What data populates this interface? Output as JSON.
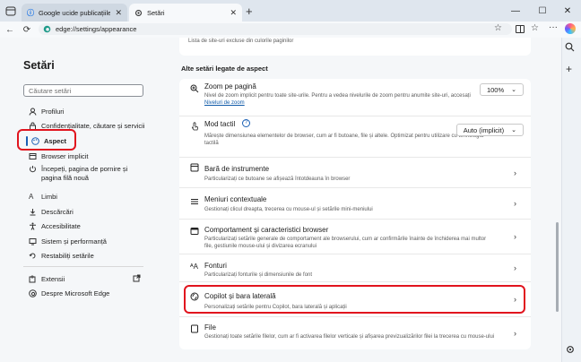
{
  "tabs": [
    {
      "title": "Google ucide publicațiile indepe"
    },
    {
      "title": "Setări"
    }
  ],
  "address": {
    "url": "edge://settings/appearance"
  },
  "sidebar": {
    "title": "Setări",
    "search_placeholder": "Căutare setări",
    "items": [
      {
        "label": "Profiluri"
      },
      {
        "label": "Confidențialitate, căutare și servicii"
      },
      {
        "label": "Aspect"
      },
      {
        "label": "Browser implicit"
      },
      {
        "label": "Începeți, pagina de pornire și"
      },
      {
        "label": "Limbi"
      },
      {
        "label": "Descărcări"
      },
      {
        "label": "Accesibilitate"
      },
      {
        "label": "Sistem și performanță"
      },
      {
        "label": "Restabiliți setările"
      },
      {
        "label": "Extensii"
      },
      {
        "label": "Despre Microsoft Edge"
      }
    ],
    "item4_line2": "pagina filă nouă"
  },
  "main": {
    "top_text": "Lista de site-uri excluse din culorile paginilor",
    "section_title": "Alte setări legate de aspect",
    "zoom": {
      "title": "Zoom pe pagină",
      "desc": "Nivel de zoom implicit pentru toate site-urile. Pentru a vedea nivelurile de zoom pentru anumite site-uri, accesați",
      "link": "Niveluri de zoom",
      "value": "100%"
    },
    "touch": {
      "title": "Mod tactil",
      "desc": "Mărește dimensiunea elementelor de browser, cum ar fi butoane, file și altele. Optimizat pentru utilizare cu tehnologia tactilă",
      "value": "Auto (implicit)"
    },
    "rows": [
      {
        "title": "Bară de instrumente",
        "desc": "Particularizați ce butoane se afișează întotdeauna în browser"
      },
      {
        "title": "Meniuri contextuale",
        "desc": "Gestionați clicul dreapta, trecerea cu mouse-ul și setările mini-meniului"
      },
      {
        "title": "Comportament și caracteristici browser",
        "desc": "Particularizați setările generale de comportament ale browserului, cum ar confirmările înainte de închiderea mai multor file, gestiunile mouse-ului și divizarea ecranului"
      },
      {
        "title": "Fonturi",
        "desc": "Particularizați fonturile și dimensiunile de font"
      },
      {
        "title": "Copilot și bara laterală",
        "desc": "Personalizați setările pentru Copilot, bara laterală și aplicații"
      },
      {
        "title": "File",
        "desc": "Gestionați toate setările filelor, cum ar fi activarea filelor verticale și afișarea previzualizărilor filei la trecerea cu mouse-ului"
      }
    ]
  }
}
